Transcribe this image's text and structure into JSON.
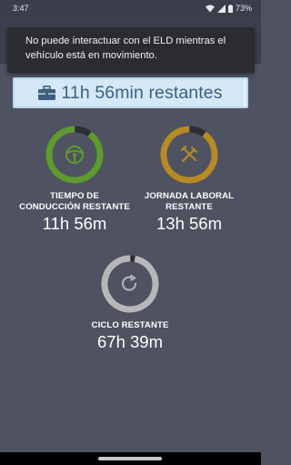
{
  "status_bar": {
    "time": "3:47",
    "battery": "73%"
  },
  "toast": {
    "message": "No puede interactuar con el ELD mientras el vehículo está en movimiento."
  },
  "hours_banner": {
    "text": "11h 56min restantes",
    "progress_fraction": 0.99
  },
  "gauges": {
    "driving": {
      "label_line1": "TIEMPO DE",
      "label_line2": "CONDUCCIÓN RESTANTE",
      "value": "11h 56m",
      "color": "#5f9a2e",
      "fraction": 0.9,
      "icon": "steering-wheel-icon"
    },
    "workday": {
      "label_line1": "JORNADA LABORAL",
      "label_line2": "RESTANTE",
      "value": "13h 56m",
      "color": "#b68a25",
      "fraction": 0.9,
      "icon": "tools-icon"
    },
    "cycle": {
      "label_line1": "CICLO RESTANTE",
      "value": "67h 39m",
      "color": "#b7b7b9",
      "fraction": 0.97,
      "icon": "refresh-icon"
    }
  }
}
